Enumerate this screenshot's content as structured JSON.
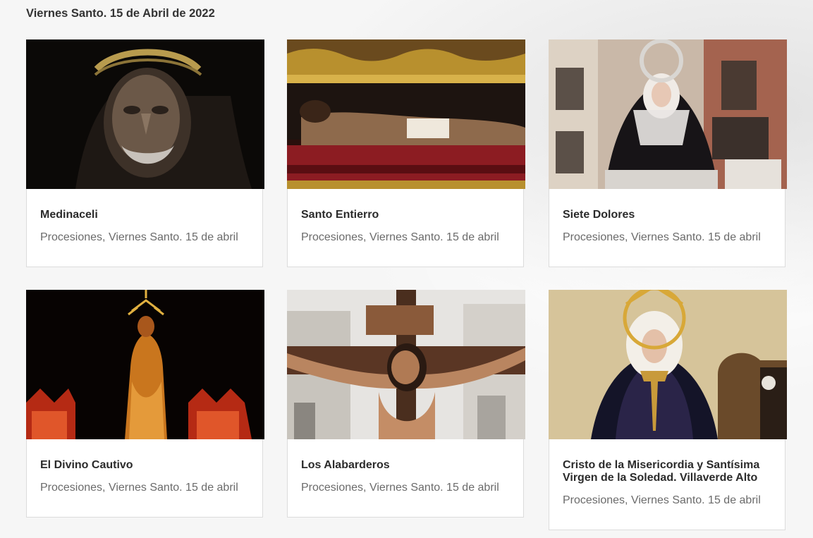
{
  "section": {
    "title": "Viernes Santo. 15 de Abril de 2022"
  },
  "cards": [
    {
      "name": "Medinaceli",
      "meta": "Procesiones, Viernes Santo. 15 de abril",
      "image": "medinaceli-photo"
    },
    {
      "name": "Santo Entierro",
      "meta": "Procesiones, Viernes Santo. 15 de abril",
      "image": "santo-entierro-photo"
    },
    {
      "name": "Siete Dolores",
      "meta": "Procesiones, Viernes Santo. 15 de abril",
      "image": "siete-dolores-photo"
    },
    {
      "name": "El Divino Cautivo",
      "meta": "Procesiones, Viernes Santo. 15 de abril",
      "image": "divino-cautivo-photo"
    },
    {
      "name": "Los Alabarderos",
      "meta": "Procesiones, Viernes Santo. 15 de abril",
      "image": "alabarderos-photo"
    },
    {
      "name": "Cristo de la Misericordia y Santísima Virgen de la Soledad. Villaverde Alto",
      "meta": "Procesiones, Viernes Santo. 15 de abril",
      "image": "cristo-misericordia-photo"
    }
  ]
}
